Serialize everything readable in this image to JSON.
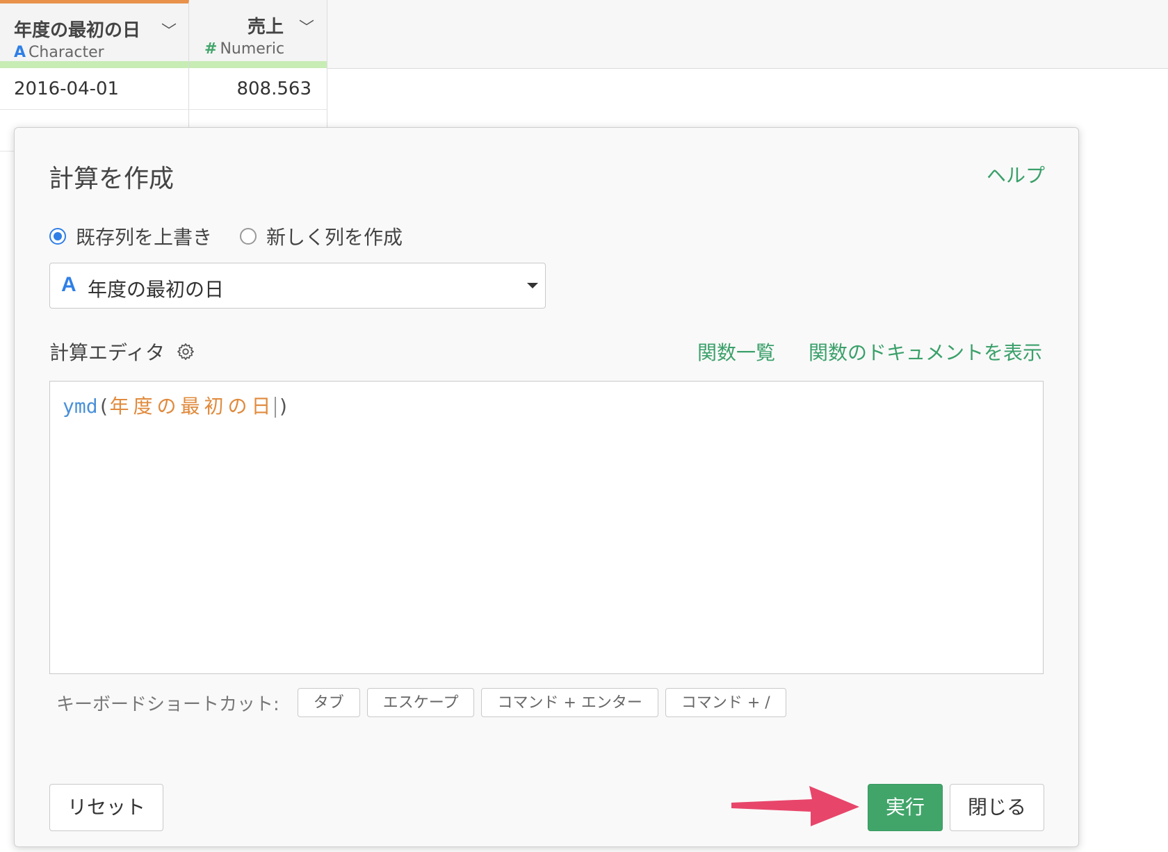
{
  "grid": {
    "columns": [
      {
        "name": "年度の最初の日",
        "type_glyph": "A",
        "type_label": "Character"
      },
      {
        "name": "売上",
        "type_glyph": "#",
        "type_label": "Numeric"
      }
    ],
    "rows": [
      {
        "date": "2016-04-01",
        "sales": "808.563"
      }
    ]
  },
  "dialog": {
    "title": "計算を作成",
    "help_link": "ヘルプ",
    "radio_overwrite": "既存列を上書き",
    "radio_new": "新しく列を作成",
    "column_select_value": "年度の最初の日",
    "column_select_icon": "A",
    "editor_label": "計算エディタ",
    "function_list_link": "関数一覧",
    "function_docs_link": "関数のドキュメントを表示",
    "code": {
      "fn": "ymd",
      "open": "(",
      "arg": "年度の最初の日",
      "close": ")"
    },
    "shortcuts_label": "キーボードショートカット:",
    "shortcuts": [
      "タブ",
      "エスケープ",
      "コマンド + エンター",
      "コマンド + /"
    ],
    "reset_button": "リセット",
    "run_button": "実行",
    "close_button": "閉じる"
  },
  "colors": {
    "accent_green": "#41a56a",
    "link_green": "#3aa06a",
    "radio_blue": "#2f7fe6",
    "code_function": "#4a90d9",
    "code_argument": "#e08a3c",
    "annotation_arrow": "#e8456a"
  }
}
